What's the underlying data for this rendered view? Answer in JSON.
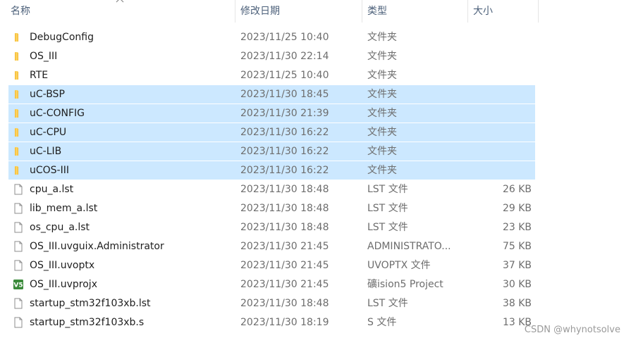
{
  "header": {
    "name_label": "名称",
    "date_label": "修改日期",
    "type_label": "类型",
    "size_label": "大小",
    "sort_arrow_icon": "chevron-up-icon"
  },
  "files": [
    {
      "name": "DebugConfig",
      "date": "2023/11/25 10:40",
      "type": "文件夹",
      "size": "",
      "icon": "folder-icon",
      "selected": false
    },
    {
      "name": "OS_III",
      "date": "2023/11/30 22:14",
      "type": "文件夹",
      "size": "",
      "icon": "folder-icon",
      "selected": false
    },
    {
      "name": "RTE",
      "date": "2023/11/25 10:40",
      "type": "文件夹",
      "size": "",
      "icon": "folder-icon",
      "selected": false
    },
    {
      "name": "uC-BSP",
      "date": "2023/11/30 18:45",
      "type": "文件夹",
      "size": "",
      "icon": "folder-icon",
      "selected": true
    },
    {
      "name": "uC-CONFIG",
      "date": "2023/11/30 21:39",
      "type": "文件夹",
      "size": "",
      "icon": "folder-icon",
      "selected": true
    },
    {
      "name": "uC-CPU",
      "date": "2023/11/30 16:22",
      "type": "文件夹",
      "size": "",
      "icon": "folder-icon",
      "selected": true
    },
    {
      "name": "uC-LIB",
      "date": "2023/11/30 16:22",
      "type": "文件夹",
      "size": "",
      "icon": "folder-icon",
      "selected": true
    },
    {
      "name": "uCOS-III",
      "date": "2023/11/30 16:22",
      "type": "文件夹",
      "size": "",
      "icon": "folder-icon",
      "selected": true
    },
    {
      "name": "cpu_a.lst",
      "date": "2023/11/30 18:48",
      "type": "LST 文件",
      "size": "26 KB",
      "icon": "file-icon",
      "selected": false
    },
    {
      "name": "lib_mem_a.lst",
      "date": "2023/11/30 18:48",
      "type": "LST 文件",
      "size": "29 KB",
      "icon": "file-icon",
      "selected": false
    },
    {
      "name": "os_cpu_a.lst",
      "date": "2023/11/30 18:48",
      "type": "LST 文件",
      "size": "23 KB",
      "icon": "file-icon",
      "selected": false
    },
    {
      "name": "OS_III.uvguix.Administrator",
      "date": "2023/11/30 21:45",
      "type": "ADMINISTRATO...",
      "size": "75 KB",
      "icon": "file-icon",
      "selected": false
    },
    {
      "name": "OS_III.uvoptx",
      "date": "2023/11/30 21:45",
      "type": "UVOPTX 文件",
      "size": "37 KB",
      "icon": "file-icon",
      "selected": false
    },
    {
      "name": "OS_III.uvprojx",
      "date": "2023/11/30 21:45",
      "type": "礦ision5 Project",
      "size": "30 KB",
      "icon": "keil-project-icon",
      "selected": false
    },
    {
      "name": "startup_stm32f103xb.lst",
      "date": "2023/11/30 18:48",
      "type": "LST 文件",
      "size": "38 KB",
      "icon": "file-icon",
      "selected": false
    },
    {
      "name": "startup_stm32f103xb.s",
      "date": "2023/11/30 18:19",
      "type": "S 文件",
      "size": "13 KB",
      "icon": "file-icon",
      "selected": false
    }
  ],
  "watermark": "CSDN @whynotsolve",
  "colors": {
    "selection": "#cce8ff",
    "folder": "#f8c74a",
    "header_text": "#4c607a",
    "secondary_text": "#6d6d6d"
  }
}
